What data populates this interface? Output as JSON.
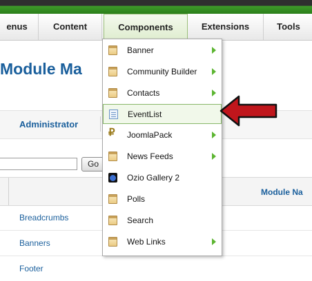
{
  "menubar": {
    "tabs": [
      {
        "label": "enus"
      },
      {
        "label": "Content"
      },
      {
        "label": "Components"
      },
      {
        "label": "Extensions"
      },
      {
        "label": "Tools"
      }
    ]
  },
  "page": {
    "title": "Module Ma",
    "sub_tab": "Administrator",
    "go_label": "Go",
    "column_header": "Module Na"
  },
  "rows": [
    "Breadcrumbs",
    "Banners",
    "Footer"
  ],
  "dropdown": {
    "items": [
      {
        "label": "Banner",
        "icon": "folder-icon",
        "submenu": true
      },
      {
        "label": "Community Builder",
        "icon": "folder-icon",
        "submenu": true
      },
      {
        "label": "Contacts",
        "icon": "folder-icon",
        "submenu": true
      },
      {
        "label": "EventList",
        "icon": "calendar-list-icon",
        "submenu": false,
        "highlighted": true
      },
      {
        "label": "JoomlaPack",
        "icon": "joomlapack-icon",
        "submenu": true
      },
      {
        "label": "News Feeds",
        "icon": "folder-icon",
        "submenu": true
      },
      {
        "label": "Ozio Gallery 2",
        "icon": "ozio-gallery-icon",
        "submenu": false
      },
      {
        "label": "Polls",
        "icon": "folder-icon",
        "submenu": false
      },
      {
        "label": "Search",
        "icon": "folder-icon",
        "submenu": false
      },
      {
        "label": "Web Links",
        "icon": "folder-icon",
        "submenu": true
      }
    ]
  },
  "colors": {
    "accent_green": "#3f9a2a",
    "link_blue": "#1a5f9c",
    "annotation_arrow": "#c0161c"
  }
}
